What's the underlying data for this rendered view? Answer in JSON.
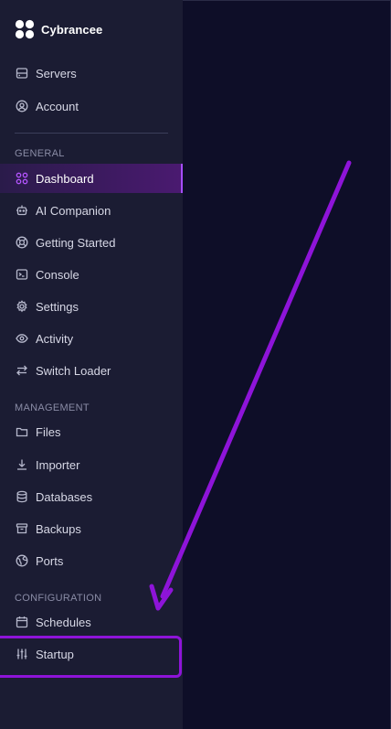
{
  "brand": {
    "name": "Cybrancee"
  },
  "top_nav": [
    {
      "label": "Servers",
      "icon": "server-icon"
    },
    {
      "label": "Account",
      "icon": "user-circle-icon"
    }
  ],
  "general": {
    "title": "GENERAL",
    "items": [
      {
        "label": "Dashboard",
        "icon": "grid-icon",
        "active": true
      },
      {
        "label": "AI Companion",
        "icon": "bot-icon"
      },
      {
        "label": "Getting Started",
        "icon": "lifebuoy-icon"
      },
      {
        "label": "Console",
        "icon": "terminal-icon"
      },
      {
        "label": "Settings",
        "icon": "gear-icon"
      },
      {
        "label": "Activity",
        "icon": "eye-icon"
      },
      {
        "label": "Switch Loader",
        "icon": "swap-arrows-icon"
      }
    ]
  },
  "management": {
    "title": "MANAGEMENT",
    "items": [
      {
        "label": "Files",
        "icon": "folder-icon"
      },
      {
        "label": "Importer",
        "icon": "download-icon"
      },
      {
        "label": "Databases",
        "icon": "database-icon"
      },
      {
        "label": "Backups",
        "icon": "archive-icon"
      },
      {
        "label": "Ports",
        "icon": "globe-icon"
      }
    ]
  },
  "configuration": {
    "title": "CONFIGURATION",
    "items": [
      {
        "label": "Schedules",
        "icon": "calendar-icon"
      },
      {
        "label": "Startup",
        "icon": "sliders-icon"
      }
    ]
  },
  "colors": {
    "sidebar_bg": "#1b1c33",
    "main_bg": "#0e0e28",
    "accent": "#a64dff",
    "annotation": "#8e14d9"
  }
}
